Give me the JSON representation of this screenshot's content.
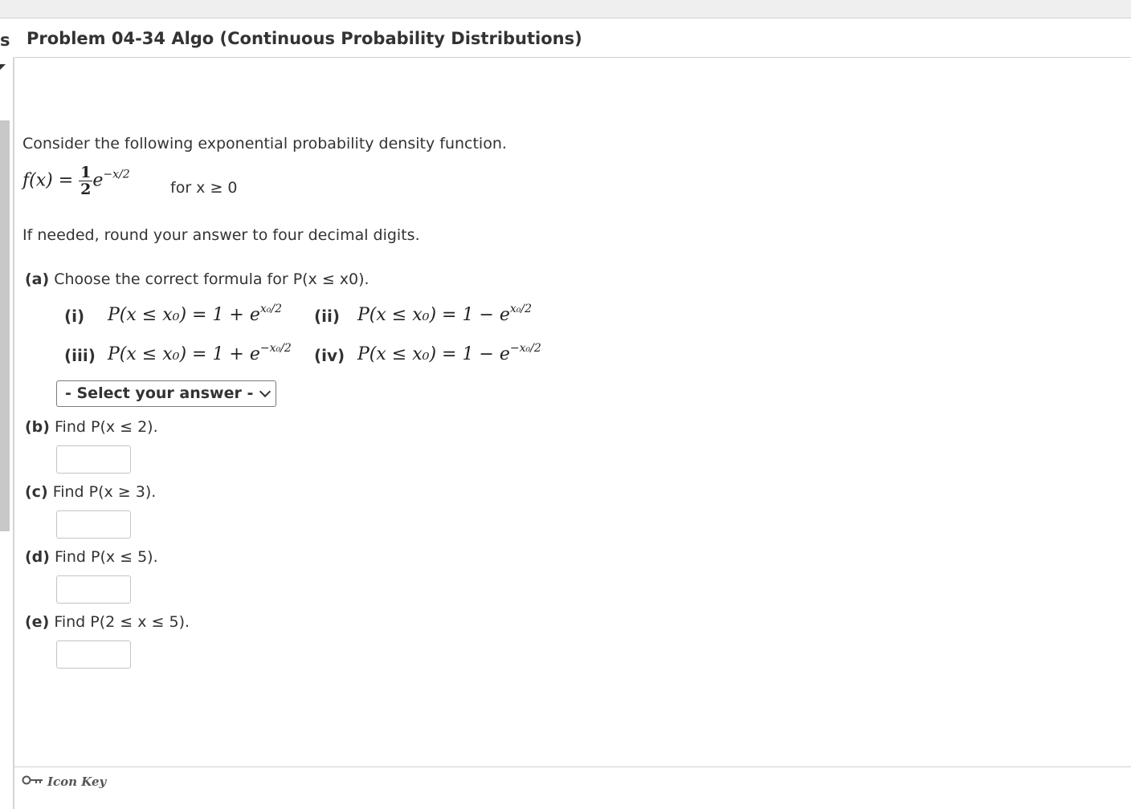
{
  "header": {
    "left_fragment": "s",
    "title": "Problem 04-34 Algo (Continuous Probability Distributions)"
  },
  "problem": {
    "intro": "Consider the following exponential probability density function.",
    "pdf": {
      "lhs": "f(x) =",
      "frac_num": "1",
      "frac_den": "2",
      "base": "e",
      "exponent": "−x/2",
      "domain": "for x ≥ 0"
    },
    "rounding_note": "If needed, round your answer to four decimal digits."
  },
  "part_a": {
    "label": "(a)",
    "prompt": "Choose the correct formula for P(x ≤ x0).",
    "options": [
      {
        "label": "(i)",
        "formula": "P(x ≤ x₀) = 1 + e",
        "exp": "x₀/2"
      },
      {
        "label": "(ii)",
        "formula": "P(x ≤ x₀) = 1 − e",
        "exp": "x₀/2"
      },
      {
        "label": "(iii)",
        "formula": "P(x ≤ x₀) = 1 + e",
        "exp": "−x₀/2"
      },
      {
        "label": "(iv)",
        "formula": "P(x ≤ x₀) = 1 − e",
        "exp": "−x₀/2"
      }
    ],
    "select_placeholder": "- Select your answer -"
  },
  "parts": [
    {
      "label": "(b)",
      "prompt": "Find P(x ≤ 2).",
      "value": ""
    },
    {
      "label": "(c)",
      "prompt": "Find P(x ≥ 3).",
      "value": ""
    },
    {
      "label": "(d)",
      "prompt": "Find P(x ≤ 5).",
      "value": ""
    },
    {
      "label": "(e)",
      "prompt": "Find P(2 ≤ x ≤ 5).",
      "value": ""
    }
  ],
  "footer": {
    "icon_key_label": "Icon Key",
    "icon": "key-icon"
  }
}
